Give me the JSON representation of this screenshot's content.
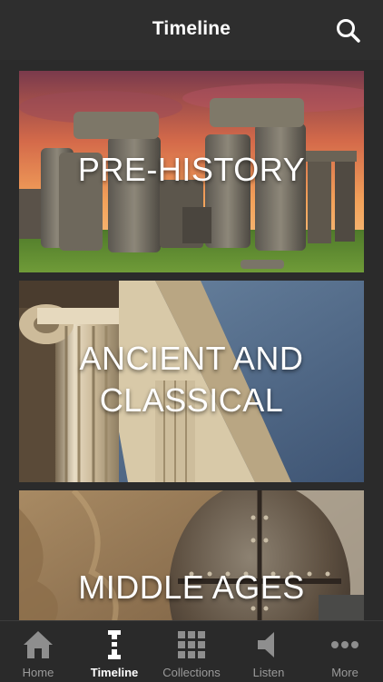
{
  "header": {
    "title": "Timeline",
    "search_icon": "search-icon"
  },
  "cards": [
    {
      "label": "PRE-HISTORY",
      "image": "stonehenge-image"
    },
    {
      "label": "ANCIENT AND CLASSICAL",
      "label_lines": [
        "ANCIENT AND",
        "CLASSICAL"
      ],
      "image": "ionic-column-image"
    },
    {
      "label": "MIDDLE AGES",
      "image": "viking-helmet-image"
    }
  ],
  "tabbar": {
    "items": [
      {
        "label": "Home",
        "icon": "home-icon",
        "active": false
      },
      {
        "label": "Timeline",
        "icon": "timeline-icon",
        "active": true
      },
      {
        "label": "Collections",
        "icon": "grid-icon",
        "active": false
      },
      {
        "label": "Listen",
        "icon": "speaker-icon",
        "active": false
      },
      {
        "label": "More",
        "icon": "more-icon",
        "active": false
      }
    ]
  },
  "colors": {
    "background": "#2b2b2b",
    "bar": "#2e2e2e",
    "active_tab": "#ffffff",
    "inactive_tab": "#9a9a9a"
  }
}
